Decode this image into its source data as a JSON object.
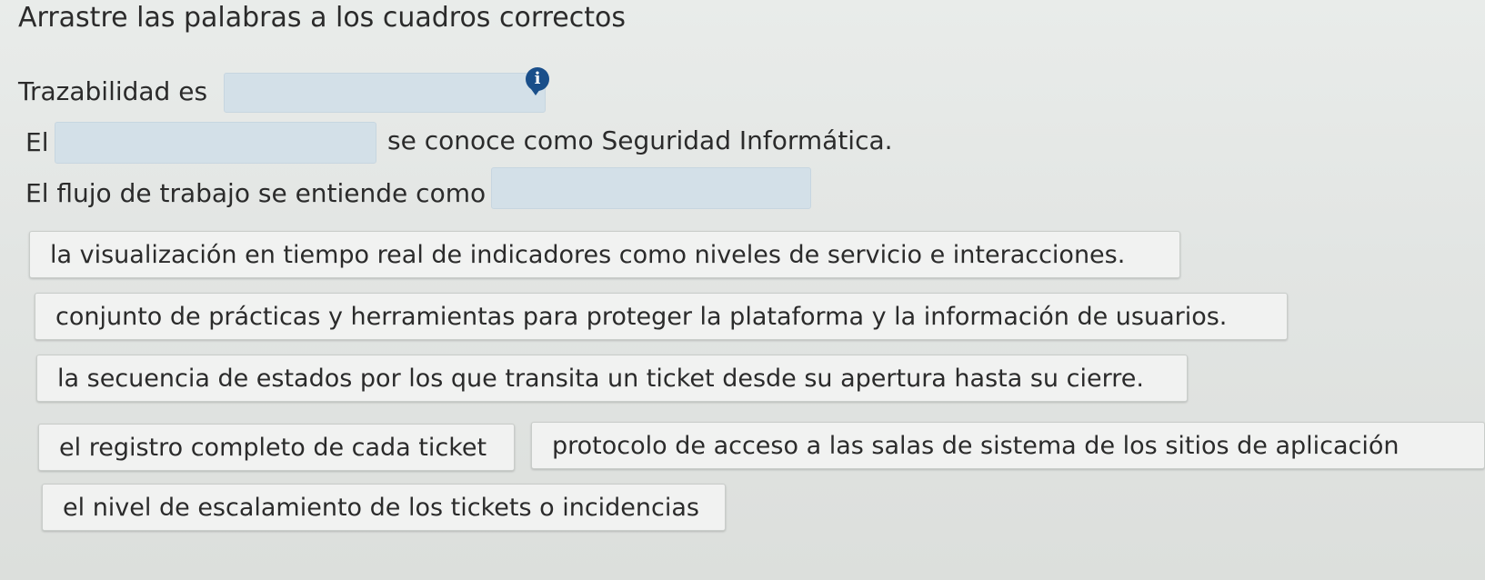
{
  "instructions": "Arrastre las palabras a los cuadros correctos",
  "sentences": [
    {
      "before": "Trazabilidad es",
      "after": ""
    },
    {
      "before": "El",
      "after": "se conoce como Seguridad Informática."
    },
    {
      "before": "El flujo de trabajo se entiende como",
      "after": ""
    }
  ],
  "info_icon": {
    "glyph": "i",
    "icon": "info-icon",
    "color": "#1a4f8a"
  },
  "options": [
    "la visualización en tiempo real de indicadores como niveles de servicio e interacciones.",
    "conjunto de prácticas y herramientas para proteger la plataforma y la información de usuarios.",
    "la secuencia de estados por los que transita un ticket desde su apertura hasta su cierre.",
    "el registro completo de cada ticket",
    "protocolo de acceso a las salas de sistema de los sitios de aplicación",
    "el nivel de escalamiento de los tickets o incidencias"
  ],
  "colors": {
    "dropzone": "#d3e0e8",
    "chip_background": "#f1f2f1",
    "background": "#e6e9e7"
  }
}
